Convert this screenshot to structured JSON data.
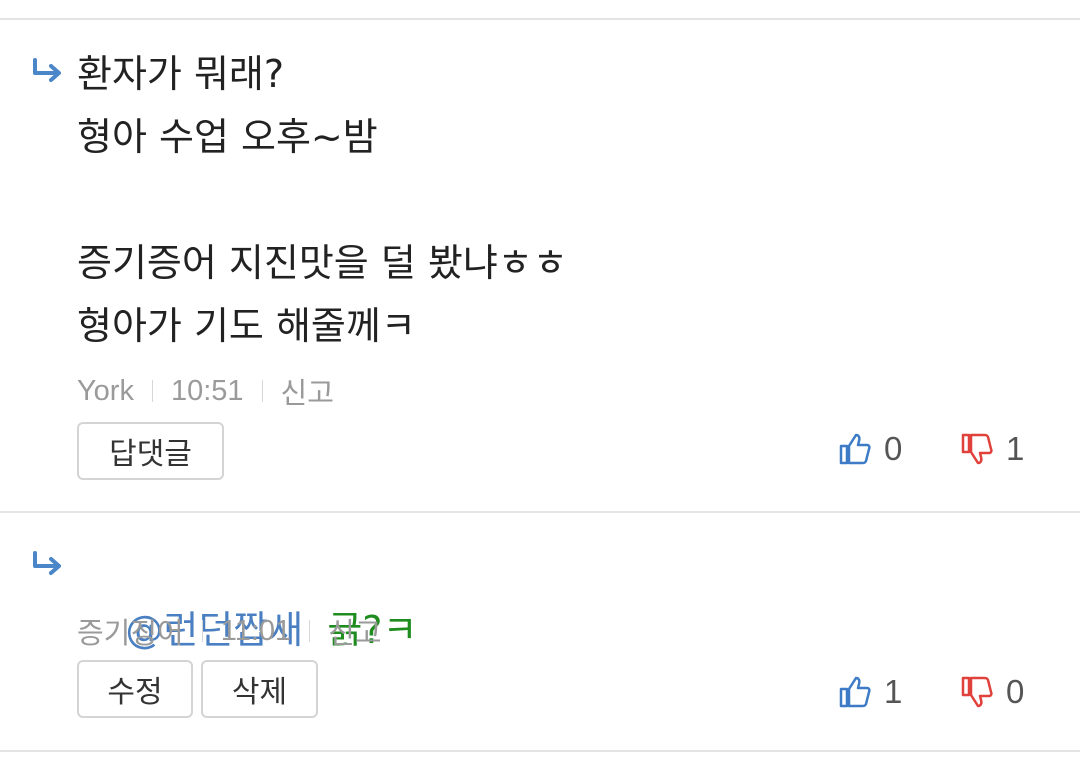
{
  "comments": [
    {
      "text": "환자가 뭐래?\n형아 수업 오후~밤\n\n증기증어 지진맛을 덜 봤냐ㅎㅎ\n형아가 기도 해줄께ㅋ",
      "author": "York",
      "time": "10:51",
      "report_label": "신고",
      "buttons": [
        "답댓글"
      ],
      "upvotes": "0",
      "downvotes": "1"
    },
    {
      "mention": "@런던짭새",
      "text": "긁?ㅋ",
      "author": "증기징어",
      "time": "11:01",
      "report_label": "신고",
      "buttons": [
        "수정",
        "삭제"
      ],
      "upvotes": "1",
      "downvotes": "0"
    }
  ],
  "colors": {
    "mention": "#4a7fc1",
    "reply_text": "#1e8c1e",
    "upvote_icon": "#3d7bc6",
    "downvote_icon": "#e0413a",
    "reply_arrow": "#4a86c8"
  }
}
